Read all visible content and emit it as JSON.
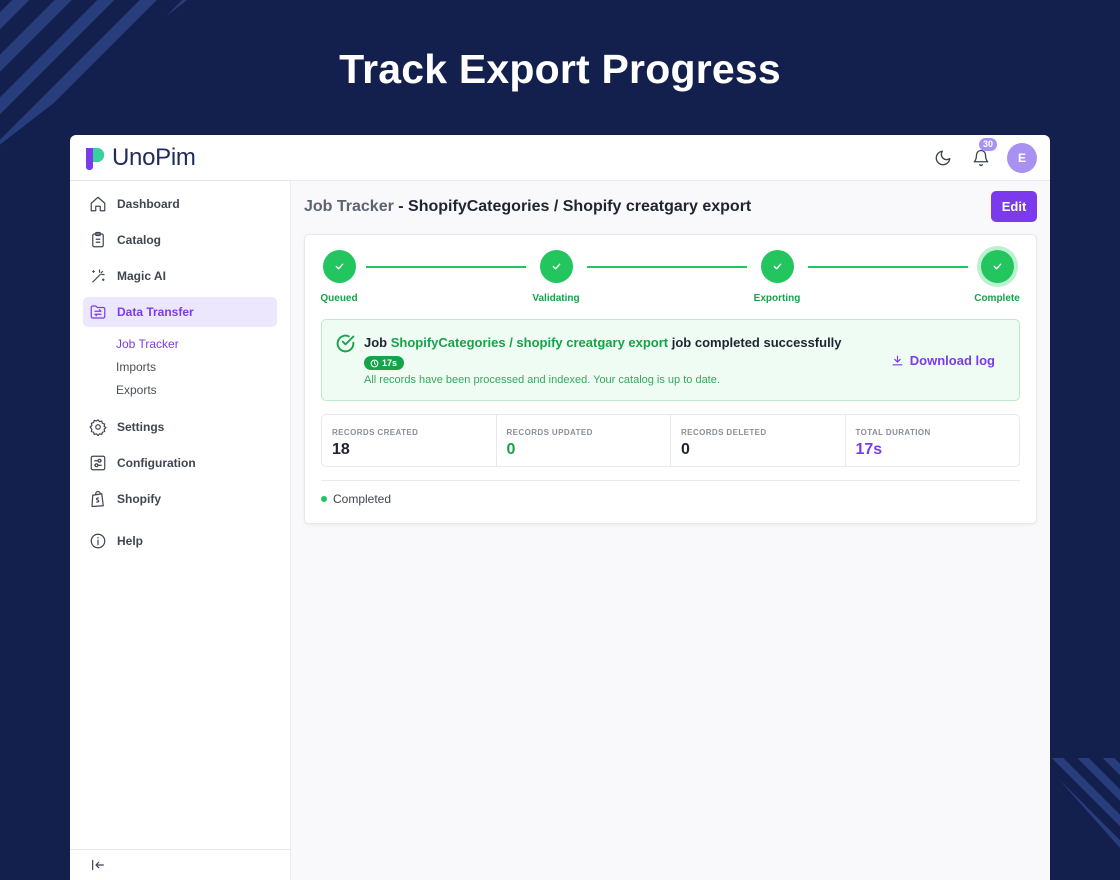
{
  "hero": {
    "title": "Track Export Progress"
  },
  "app": {
    "logo_text": "UnoPim",
    "notification_count": "30",
    "avatar_initial": "E"
  },
  "sidebar": {
    "items": [
      {
        "label": "Dashboard",
        "icon": "home-icon"
      },
      {
        "label": "Catalog",
        "icon": "clipboard-icon"
      },
      {
        "label": "Magic AI",
        "icon": "magic-wand-icon"
      },
      {
        "label": "Data Transfer",
        "icon": "folder-transfer-icon",
        "active": true
      },
      {
        "label": "Settings",
        "icon": "gear-icon"
      },
      {
        "label": "Configuration",
        "icon": "sliders-icon"
      },
      {
        "label": "Shopify",
        "icon": "shopify-bag-icon"
      },
      {
        "label": "Help",
        "icon": "info-icon"
      }
    ],
    "sub_items": [
      "Job Tracker",
      "Imports",
      "Exports"
    ]
  },
  "page": {
    "title_prefix": "Job Tracker",
    "title_separator": " - ",
    "title_job": "ShopifyCategories / Shopify creatgary export",
    "edit_label": "Edit"
  },
  "steps": [
    {
      "label": "Queued"
    },
    {
      "label": "Validating"
    },
    {
      "label": "Exporting"
    },
    {
      "label": "Complete"
    }
  ],
  "success": {
    "prefix": "Job ",
    "job_name": "ShopifyCategories / shopify creatgary export",
    "suffix": " job completed successfully",
    "duration": "17s",
    "message": "All records have been processed and indexed. Your catalog is up to date.",
    "download_label": "Download log"
  },
  "stats": [
    {
      "label": "RECORDS CREATED",
      "value": "18",
      "color": "#1e2430"
    },
    {
      "label": "RECORDS UPDATED",
      "value": "0",
      "color": "#16a34a"
    },
    {
      "label": "RECORDS DELETED",
      "value": "0",
      "color": "#1e2430"
    },
    {
      "label": "TOTAL DURATION",
      "value": "17s",
      "color": "#7c3aed"
    }
  ],
  "status": {
    "label": "Completed"
  },
  "colors": {
    "accent": "#7c3aed",
    "success": "#22c55e",
    "background": "#13204d"
  }
}
